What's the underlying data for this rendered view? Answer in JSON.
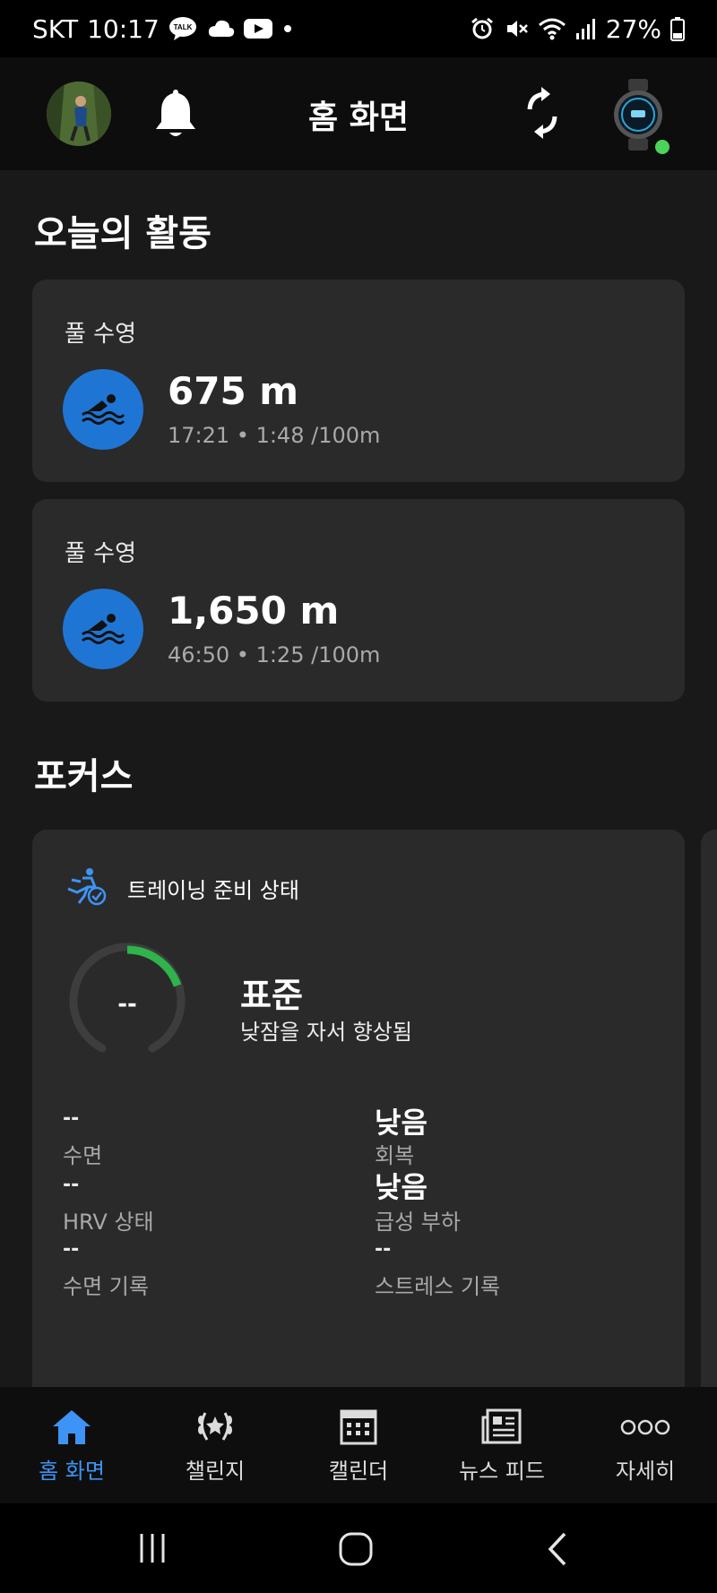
{
  "status_bar": {
    "carrier": "SKT",
    "time": "10:17",
    "talk_badge": "TALK",
    "battery": "27%"
  },
  "header": {
    "title": "홈 화면"
  },
  "today": {
    "section_title": "오늘의 활동",
    "activities": [
      {
        "type": "풀 수영",
        "distance": "675 m",
        "meta": "17:21 • 1:48 /100m"
      },
      {
        "type": "풀 수영",
        "distance": "1,650 m",
        "meta": "46:50 • 1:25 /100m"
      }
    ]
  },
  "focus": {
    "section_title": "포커스",
    "training_readiness": {
      "label": "트레이닝 준비 상태",
      "gauge_value": "--",
      "status": "표준",
      "description": "낮잠을 자서 향상됨",
      "metrics": [
        {
          "value": "--",
          "label": "수면"
        },
        {
          "value": "낮음",
          "label": "회복"
        },
        {
          "value": "--",
          "label": "HRV 상태"
        },
        {
          "value": "낮음",
          "label": "급성 부하"
        },
        {
          "value": "--",
          "label": "수면 기록"
        },
        {
          "value": "--",
          "label": "스트레스 기록"
        }
      ]
    }
  },
  "bottom_nav": {
    "items": [
      {
        "label": "홈 화면",
        "icon": "home-icon",
        "active": true
      },
      {
        "label": "챌린지",
        "icon": "laurel-icon",
        "active": false
      },
      {
        "label": "캘린더",
        "icon": "calendar-icon",
        "active": false
      },
      {
        "label": "뉴스 피드",
        "icon": "news-icon",
        "active": false
      },
      {
        "label": "자세히",
        "icon": "more-icon",
        "active": false
      }
    ]
  },
  "colors": {
    "accent_blue": "#3d94f5",
    "swim_blue": "#1f75d4",
    "gauge_green": "#2fb34a",
    "online_green": "#4cd35a"
  }
}
